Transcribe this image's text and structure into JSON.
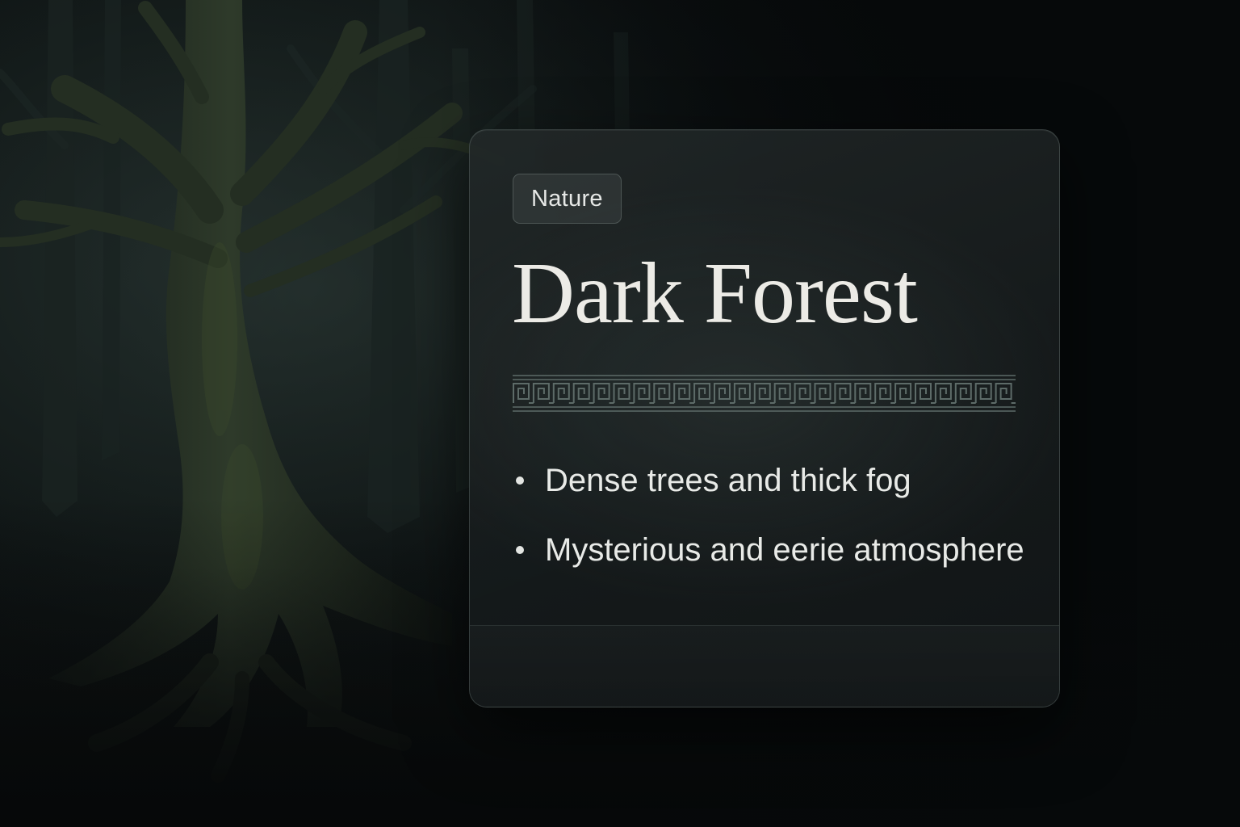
{
  "card": {
    "tag": "Nature",
    "title": "Dark Forest",
    "bullets": [
      "Dense trees and thick fog",
      "Mysterious and eerie atmosphere"
    ]
  },
  "colors": {
    "background": "#080b0c",
    "card": "#1c2223",
    "text": "#ecebe6",
    "accent": "#5d6b68"
  }
}
